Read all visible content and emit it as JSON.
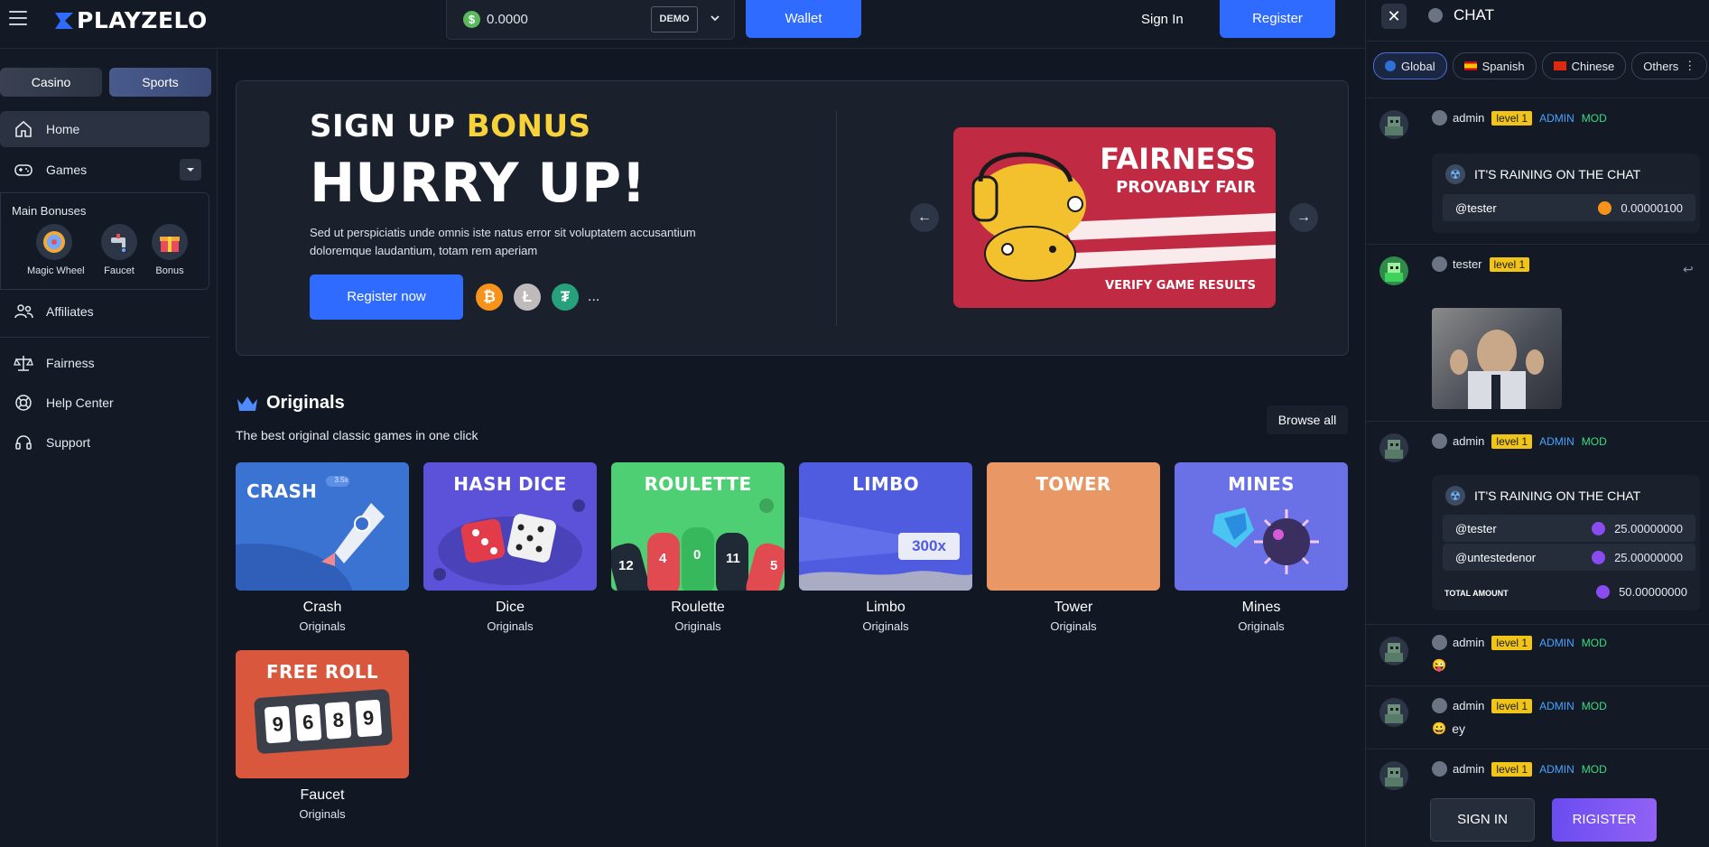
{
  "brand": {
    "name": "PLAYZELO"
  },
  "topbar": {
    "balance": "0.0000",
    "mode": "DEMO",
    "wallet_label": "Wallet",
    "signin_label": "Sign In",
    "register_label": "Register"
  },
  "sidebar": {
    "tabs": [
      "Casino",
      "Sports"
    ],
    "home": "Home",
    "games": "Games",
    "bonuses_title": "Main Bonuses",
    "bonuses": [
      "Magic Wheel",
      "Faucet",
      "Bonus"
    ],
    "affiliates": "Affiliates",
    "fairness": "Fairness",
    "help": "Help Center",
    "support": "Support"
  },
  "hero": {
    "signup": "SIGN UP",
    "bonus": "BONUS",
    "headline": "HURRY UP!",
    "description": "Sed ut perspiciatis unde omnis iste natus error sit voluptatem accusantium doloremque laudantium, totam rem aperiam",
    "cta": "Register now",
    "more": "...",
    "slide": {
      "title": "FAIRNESS",
      "subtitle": "PROVABLY FAIR",
      "footer": "VERIFY GAME RESULTS"
    }
  },
  "originals": {
    "title": "Originals",
    "subtitle": "The best original classic games in one click",
    "browse_label": "Browse all",
    "games": [
      {
        "thumb": "CRASH",
        "name": "Crash",
        "category": "Originals",
        "color": "#3b73d3"
      },
      {
        "thumb": "HASH DICE",
        "name": "Dice",
        "category": "Originals",
        "color": "#5b52d9"
      },
      {
        "thumb": "ROULETTE",
        "name": "Roulette",
        "category": "Originals",
        "color": "#4fcf74"
      },
      {
        "thumb": "LIMBO",
        "name": "Limbo",
        "category": "Originals",
        "color": "#4f5ce0"
      },
      {
        "thumb": "TOWER",
        "name": "Tower",
        "category": "Originals",
        "color": "#e99865"
      },
      {
        "thumb": "MINES",
        "name": "Mines",
        "category": "Originals",
        "color": "#6a70e6"
      },
      {
        "thumb": "FREE ROLL",
        "name": "Faucet",
        "category": "Originals",
        "color": "#d9583d"
      }
    ],
    "roulette_numbers": [
      "12",
      "4",
      "0",
      "11",
      "5"
    ],
    "limbo_multiplier": "300x",
    "faucet_digits": [
      "9",
      "6",
      "8",
      "9"
    ],
    "crash_badge": "3.5x"
  },
  "chat": {
    "title": "CHAT",
    "languages": [
      "Global",
      "Spanish",
      "Chinese",
      "Others"
    ],
    "messages": [
      {
        "user": "admin",
        "level": "level 1",
        "admin": "ADMIN",
        "mod": "MOD",
        "rain": {
          "title": "IT'S RAINING ON THE CHAT",
          "rows": [
            {
              "user": "@tester",
              "amount": "0.00000100"
            }
          ]
        }
      },
      {
        "user": "tester",
        "level": "level 1"
      },
      {
        "user": "admin",
        "level": "level 1",
        "admin": "ADMIN",
        "mod": "MOD",
        "rain": {
          "title": "IT'S RAINING ON THE CHAT",
          "rows": [
            {
              "user": "@tester",
              "amount": "25.00000000"
            },
            {
              "user": "@untestedenor",
              "amount": "25.00000000"
            }
          ],
          "total_label": "TOTAL AMOUNT",
          "total": "50.00000000"
        }
      },
      {
        "user": "admin",
        "level": "level 1",
        "admin": "ADMIN",
        "mod": "MOD",
        "text": "",
        "emoji": "😜"
      },
      {
        "user": "admin",
        "level": "level 1",
        "admin": "ADMIN",
        "mod": "MOD",
        "text": "ey",
        "emoji": "😀"
      },
      {
        "user": "admin",
        "level": "level 1",
        "admin": "ADMIN",
        "mod": "MOD"
      }
    ],
    "signin_label": "SIGN IN",
    "register_label": "RIGISTER"
  }
}
